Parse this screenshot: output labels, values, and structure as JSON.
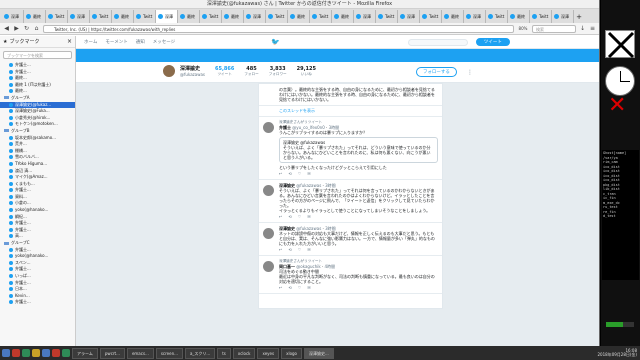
{
  "window": {
    "title": "深澤諭史(@fukazawas) さん | Twitter からの返信付きツイート - Mozilla Firefox"
  },
  "tabs": [
    {
      "label": "深澤"
    },
    {
      "label": "最終"
    },
    {
      "label": "Twitt"
    },
    {
      "label": "深澤"
    },
    {
      "label": "Twitt"
    },
    {
      "label": "最終"
    },
    {
      "label": "Twitt"
    },
    {
      "label": "深澤"
    },
    {
      "label": "最終"
    },
    {
      "label": "Twitt"
    },
    {
      "label": "最終"
    },
    {
      "label": "深澤"
    },
    {
      "label": "Twitt"
    },
    {
      "label": "最終"
    },
    {
      "label": "Twitt"
    },
    {
      "label": "最終"
    },
    {
      "label": "深澤"
    },
    {
      "label": "Twitt"
    },
    {
      "label": "深澤"
    },
    {
      "label": "Twitt"
    },
    {
      "label": "最終"
    },
    {
      "label": "深澤"
    },
    {
      "label": "Twitt"
    },
    {
      "label": "最終"
    },
    {
      "label": "Twitt"
    },
    {
      "label": "深澤"
    }
  ],
  "navbar": {
    "url": "Twitter, Inc. (US) | https://twitter.com/fukazawas/with_replies",
    "zoom": "80%",
    "search_placeholder": "検索"
  },
  "sidebar": {
    "title": "ブックマーク",
    "search_placeholder": "ブックマークを検索",
    "items": [
      {
        "label": "弁護士...",
        "type": "link"
      },
      {
        "label": "弁護士...",
        "type": "link"
      },
      {
        "label": "最終...",
        "type": "link"
      },
      {
        "label": "最終 1 (ITは弁護士)",
        "type": "link"
      },
      {
        "label": "最終...",
        "type": "link"
      },
      {
        "label": "グループA",
        "type": "folder"
      },
      {
        "label": "深澤諭史(@fukaz...",
        "type": "link",
        "selected": true
      },
      {
        "label": "深澤諭史(@Fuka...",
        "type": "link"
      },
      {
        "label": "小倉秀夫(@hirok...",
        "type": "link"
      },
      {
        "label": "モトケン(@motoken...",
        "type": "link"
      },
      {
        "label": "グループB",
        "type": "folder"
      },
      {
        "label": "坂本史郎(@sakamo...",
        "type": "link"
      },
      {
        "label": "荒井...",
        "type": "link"
      },
      {
        "label": "棚橋...",
        "type": "link"
      },
      {
        "label": "雪のバルバ...",
        "type": "link"
      },
      {
        "label": "TYoko Higuma...",
        "type": "link"
      },
      {
        "label": "渡辺 清...",
        "type": "link"
      },
      {
        "label": "マイク(@Amaz...",
        "type": "link"
      },
      {
        "label": "くまもも...",
        "type": "link"
      },
      {
        "label": "弁護士...",
        "type": "link"
      },
      {
        "label": "資料...",
        "type": "link"
      },
      {
        "label": "小倉の...",
        "type": "link"
      },
      {
        "label": "yoko(@hanako...",
        "type": "link"
      },
      {
        "label": "綱紀...",
        "type": "link"
      },
      {
        "label": "弁護士...",
        "type": "link"
      },
      {
        "label": "弁護士...",
        "type": "link"
      },
      {
        "label": "高...",
        "type": "link"
      },
      {
        "label": "グループC",
        "type": "folder"
      },
      {
        "label": "弁護士...",
        "type": "link"
      },
      {
        "label": "yoko(@hanako...",
        "type": "link"
      },
      {
        "label": "スペン...",
        "type": "link"
      },
      {
        "label": "弁護士...",
        "type": "link"
      },
      {
        "label": "いっぱ...",
        "type": "link"
      },
      {
        "label": "弁護士...",
        "type": "link"
      },
      {
        "label": "日本...",
        "type": "link"
      },
      {
        "label": "Kevin...",
        "type": "link"
      },
      {
        "label": "弁護士...",
        "type": "link"
      }
    ]
  },
  "twitter_nav": {
    "home": "ホーム",
    "moments": "モーメント",
    "notifications": "通知",
    "messages": "メッセージ",
    "tweet_button": "ツイート"
  },
  "profile": {
    "name": "深澤諭史",
    "handle": "@fukazawas",
    "stats": [
      {
        "label": "ツイート",
        "value": "65,866",
        "active": true
      },
      {
        "label": "フォロー",
        "value": "485"
      },
      {
        "label": "フォロワー",
        "value": "3,833"
      },
      {
        "label": "いいね",
        "value": "29,125"
      }
    ],
    "follow_button": "フォローする"
  },
  "timeline": {
    "top_fragment": "の言葉）。最終的な主張をする時、自由の身になるために、最初から相談者を見捨てるわけにはいかない。最終的な主張をする時、自由の身になるために、最初から相談者を見捨てるわけにはいかない。",
    "more_link": "このスレッドを表示",
    "tweets": [
      {
        "context": "深澤諭史さんがリツイート",
        "name": "弁護士",
        "handle": "@yu_co_lfex0n0",
        "time": "3時間",
        "text": "うんこがリブライするのは暴リプに入りますか？",
        "text2": "という暴リプをしたくなったけどグッとこらえて引用にした",
        "quote_name": "深澤諭史 @fukazawas",
        "quote_text": "そういえば、よく「暴リプされた」ってそれは、どういう意味で使っているのか分からない。あんなにひどいことを言われたのに、私は何も悪くない、向こうが悪いと思う人がいる。"
      },
      {
        "context": "",
        "name": "深澤諭史",
        "handle": "@fukazawas",
        "time": "3時間",
        "text": "そういえば、よく「暴リプされた」ってそれは何を言っているのかわからないときがある。あんなにひどい言葉を言われたのかはよくわからないけど。イラッとしたことを言ったらその方がのページに飛んで、「ツイートと返信」をクリックして見ていたらわかった。",
        "text2": "イラっとくるよりもイラっとして使うことになってしまいそうなことをしましょう。",
        "quote_name": "",
        "quote_text": ""
      },
      {
        "context": "",
        "name": "深澤諭史",
        "handle": "@fukazawas",
        "time": "3時間",
        "text": "ネットの誹謗中傷の対応も大事だけど、情報を正しく伝えるのも大事だと思う。もともと自分は、実は、そんなに強い影響力はない。一方で、情報量が多い「弾丸」的なものにも力を入れた方がいいと思う。",
        "text2": "",
        "quote_name": "",
        "quote_text": ""
      },
      {
        "context": "深澤諭史さんがリツイート",
        "name": "岡口基一",
        "handle": "@okaguchik",
        "time": "4時間",
        "text": "司法をめぐる動き中間",
        "text2": "最近は中身の平凡な判断がなく、司法の判断も慎重になっている。最も良いのは自分の対応を適切にすること。",
        "quote_name": "",
        "quote_text": ""
      }
    ]
  },
  "terminal": {
    "lines": [
      "Ghost[name]",
      "/var/ya",
      "rim_cam",
      "ico_dist",
      "ico_dist",
      "ico_dist",
      "ico_dist",
      "pkg_dist",
      "lib_dist",
      "c_tran",
      "ic_fin",
      "m_exe_dc",
      "ru_test",
      "re_fin",
      "d_test"
    ]
  },
  "taskbar": {
    "tasks": [
      {
        "label": "アラーム"
      },
      {
        "label": "pwcrt..."
      },
      {
        "label": "emacs..."
      },
      {
        "label": "screen..."
      },
      {
        "label": "a_スクリ..."
      },
      {
        "label": "ts"
      },
      {
        "label": "xclock"
      },
      {
        "label": "xeyes"
      },
      {
        "label": "xlogo"
      },
      {
        "label": "深澤諭史..."
      }
    ],
    "time": "16:08",
    "date": "2018年09月28日(金)"
  },
  "gauge": {
    "fraction": 0.6
  },
  "colors": {
    "twitter_blue": "#1da1f2",
    "selection": "#2a6dd3",
    "desktop": "#000000"
  }
}
